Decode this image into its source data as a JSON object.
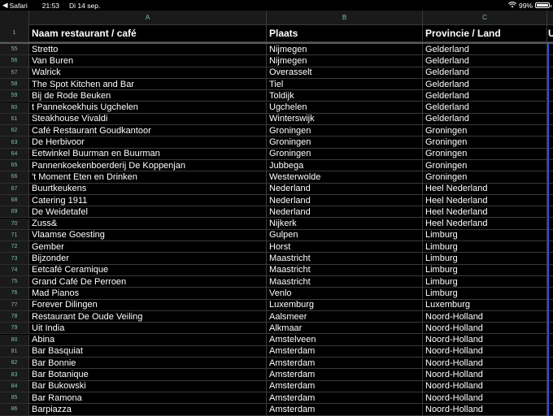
{
  "status": {
    "back_label": "Safari",
    "time": "21:53",
    "date": "Di 14 sep.",
    "battery": "99%"
  },
  "columns": [
    "A",
    "B",
    "C"
  ],
  "header": {
    "row_number": "1",
    "col_a": "Naam restaurant / café",
    "col_b": "Plaats",
    "col_c": "Provincie / Land",
    "col_d": "U"
  },
  "rows": [
    {
      "num": "55",
      "name": "Stretto",
      "place": "Nijmegen",
      "province": "Gelderland"
    },
    {
      "num": "56",
      "name": "Van Buren",
      "place": "Nijmegen",
      "province": "Gelderland"
    },
    {
      "num": "57",
      "name": "Walrick",
      "place": "Overasselt",
      "province": "Gelderland"
    },
    {
      "num": "58",
      "name": "The Spot Kitchen and Bar",
      "place": "Tiel",
      "province": "Gelderland"
    },
    {
      "num": "59",
      "name": "Bij de Rode Beuken",
      "place": "Toldijk",
      "province": "Gelderland"
    },
    {
      "num": "60",
      "name": "t Pannekoekhuis Ugchelen",
      "place": "Ugchelen",
      "province": "Gelderland"
    },
    {
      "num": "61",
      "name": "Steakhouse Vivaldi",
      "place": "Winterswijk",
      "province": "Gelderland"
    },
    {
      "num": "62",
      "name": "Café Restaurant Goudkantoor",
      "place": "Groningen",
      "province": "Groningen"
    },
    {
      "num": "63",
      "name": "De Herbivoor",
      "place": "Groningen",
      "province": "Groningen"
    },
    {
      "num": "64",
      "name": "Eetwinkel Buurman en Buurman",
      "place": "Groningen",
      "province": "Groningen"
    },
    {
      "num": "65",
      "name": "Pannenkoekenboerderij De Koppenjan",
      "place": "Jubbega",
      "province": "Groningen"
    },
    {
      "num": "66",
      "name": "'t Moment Eten en Drinken",
      "place": "Westerwolde",
      "province": "Groningen"
    },
    {
      "num": "67",
      "name": "Buurtkeukens",
      "place": "Nederland",
      "province": "Heel Nederland"
    },
    {
      "num": "68",
      "name": "Catering 1911",
      "place": "Nederland",
      "province": "Heel Nederland"
    },
    {
      "num": "69",
      "name": "De Weidetafel",
      "place": "Nederland",
      "province": "Heel Nederland"
    },
    {
      "num": "70",
      "name": "Zuss&",
      "place": "Nijkerk",
      "province": "Heel Nederland"
    },
    {
      "num": "71",
      "name": "Vlaamse Goesting",
      "place": "Gulpen",
      "province": "Limburg"
    },
    {
      "num": "72",
      "name": "Gember",
      "place": "Horst",
      "province": "Limburg"
    },
    {
      "num": "73",
      "name": "Bijzonder",
      "place": "Maastricht",
      "province": "Limburg"
    },
    {
      "num": "74",
      "name": "Eetcafé Ceramique",
      "place": "Maastricht",
      "province": "Limburg"
    },
    {
      "num": "75",
      "name": "Grand Café De Perroen",
      "place": "Maastricht",
      "province": "Limburg"
    },
    {
      "num": "76",
      "name": "Mad Pianos",
      "place": "Venlo",
      "province": "Limburg"
    },
    {
      "num": "77",
      "name": "Forever Dilingen",
      "place": "Luxemburg",
      "province": "Luxemburg"
    },
    {
      "num": "78",
      "name": "Restaurant De Oude Veiling",
      "place": "Aalsmeer",
      "province": "Noord-Holland"
    },
    {
      "num": "79",
      "name": "Uit India",
      "place": "Alkmaar",
      "province": "Noord-Holland"
    },
    {
      "num": "80",
      "name": "Abina",
      "place": "Amstelveen",
      "province": "Noord-Holland"
    },
    {
      "num": "81",
      "name": "Bar Basquiat",
      "place": "Amsterdam",
      "province": "Noord-Holland"
    },
    {
      "num": "82",
      "name": "Bar Bonnie",
      "place": "Amsterdam",
      "province": "Noord-Holland"
    },
    {
      "num": "83",
      "name": "Bar Botanique",
      "place": "Amsterdam",
      "province": "Noord-Holland"
    },
    {
      "num": "84",
      "name": "Bar Bukowski",
      "place": "Amsterdam",
      "province": "Noord-Holland"
    },
    {
      "num": "85",
      "name": "Bar Ramona",
      "place": "Amsterdam",
      "province": "Noord-Holland"
    },
    {
      "num": "86",
      "name": "Barpiazza",
      "place": "Amsterdam",
      "province": "Noord-Holland"
    }
  ]
}
